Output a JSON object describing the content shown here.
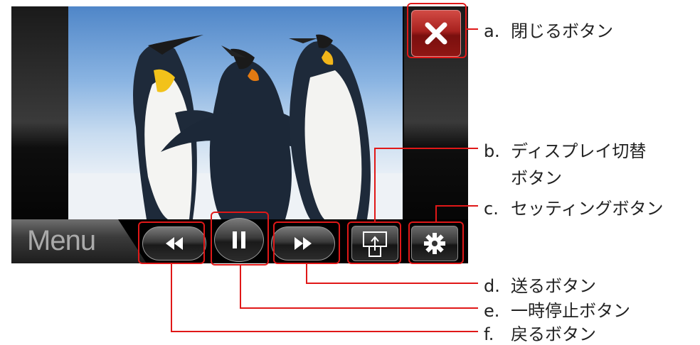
{
  "player": {
    "menu_label": "Menu",
    "photo_subject": "penguins"
  },
  "buttons": {
    "close": {
      "icon": "close-icon",
      "symbol": "✕"
    },
    "rewind": {
      "icon": "rewind-icon",
      "symbol": "◀◀"
    },
    "pause": {
      "icon": "pause-icon",
      "symbol": "II"
    },
    "forward": {
      "icon": "fast-forward-icon",
      "symbol": "▶▶"
    },
    "display": {
      "icon": "display-switch-icon"
    },
    "settings": {
      "icon": "gear-icon",
      "symbol": "✱"
    }
  },
  "annotations": {
    "a": {
      "letter": "a.",
      "text": "閉じるボタン"
    },
    "b": {
      "letter": "b.",
      "text": "ディスプレイ切替",
      "text2": "ボタン"
    },
    "c": {
      "letter": "c.",
      "text": "セッティングボタン"
    },
    "d": {
      "letter": "d.",
      "text": "送るボタン"
    },
    "e": {
      "letter": "e.",
      "text": "一時停止ボタン"
    },
    "f": {
      "letter": "f.",
      "text": "戻るボタン"
    }
  },
  "colors": {
    "highlight": "#e01818",
    "close_button": "#a8221f"
  }
}
